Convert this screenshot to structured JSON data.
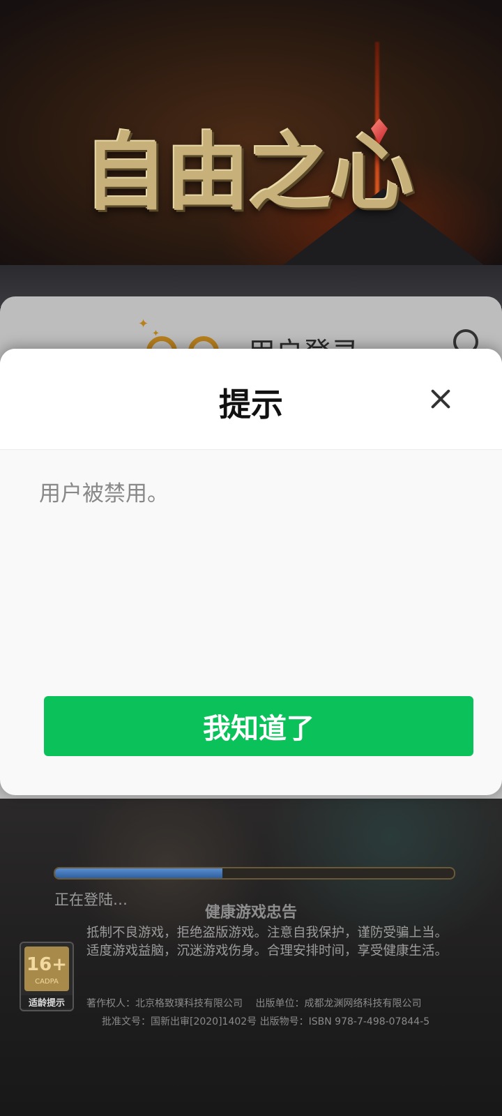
{
  "game": {
    "title": "自由之心"
  },
  "login_panel": {
    "title": "用户登录"
  },
  "dialog": {
    "title": "提示",
    "message": "用户被禁用。",
    "confirm_label": "我知道了"
  },
  "loading": {
    "text": "正在登陆…",
    "progress": 0.42
  },
  "notice": {
    "title": "健康游戏忠告",
    "lines": [
      "抵制不良游戏，拒绝盗版游戏。注意自我保护，谨防受骗上当。",
      "适度游戏益脑，沉迷游戏伤身。合理安排时间，享受健康生活。"
    ]
  },
  "copyright": {
    "line1": "著作权人：北京格致璞科技有限公司　 出版单位：成都龙渊网络科技有限公司",
    "line2": "批准文号：国新出审[2020]1402号 出版物号：ISBN 978-7-498-07844-5"
  },
  "age_rating": {
    "age": "16+",
    "org": "CADPA",
    "label": "适龄提示"
  },
  "colors": {
    "accent": "#0ac15a",
    "progress": "#4a7fc4"
  }
}
